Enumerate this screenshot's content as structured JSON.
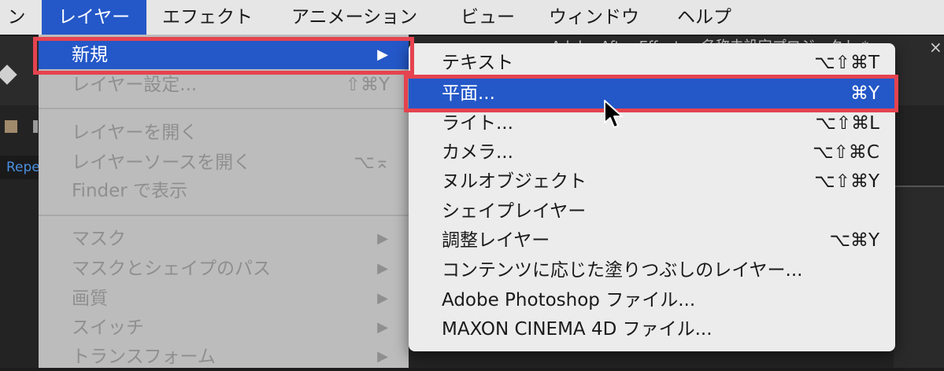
{
  "app": {
    "window_title": "Adobe After Effects - 名称未設定プロジェクト *",
    "panel_tab_fragment": "Repe"
  },
  "menubar": {
    "items": [
      {
        "label": "ン"
      },
      {
        "label": "レイヤー",
        "active": true
      },
      {
        "label": "エフェクト"
      },
      {
        "label": "アニメーション"
      },
      {
        "label": "ビュー"
      },
      {
        "label": "ウィンドウ"
      },
      {
        "label": "ヘルプ"
      }
    ]
  },
  "layer_menu": {
    "items": [
      {
        "label": "新規",
        "submenu_arrow": "▶",
        "active": true,
        "enabled": true
      },
      {
        "label": "レイヤー設定...",
        "shortcut": "⇧⌘Y",
        "enabled": false
      },
      {
        "label": "レイヤーを開く",
        "enabled": false
      },
      {
        "label": "レイヤーソースを開く",
        "shortcut": "⌥⌅",
        "enabled": false
      },
      {
        "label": "Finder で表示",
        "enabled": false
      },
      {
        "label": "マスク",
        "submenu_arrow": "▶",
        "enabled": false
      },
      {
        "label": "マスクとシェイプのパス",
        "submenu_arrow": "▶",
        "enabled": false
      },
      {
        "label": "画質",
        "submenu_arrow": "▶",
        "enabled": false
      },
      {
        "label": "スイッチ",
        "submenu_arrow": "▶",
        "enabled": false
      },
      {
        "label": "トランスフォーム",
        "submenu_arrow": "▶",
        "enabled": false
      }
    ]
  },
  "new_submenu": {
    "items": [
      {
        "label": "テキスト",
        "shortcut": "⌥⇧⌘T"
      },
      {
        "label": "平面...",
        "shortcut": "⌘Y",
        "active": true
      },
      {
        "label": "ライト...",
        "shortcut": "⌥⇧⌘L"
      },
      {
        "label": "カメラ...",
        "shortcut": "⌥⇧⌘C"
      },
      {
        "label": "ヌルオブジェクト",
        "shortcut": "⌥⇧⌘Y"
      },
      {
        "label": "シェイプレイヤー",
        "shortcut": ""
      },
      {
        "label": "調整レイヤー",
        "shortcut": "⌥⌘Y"
      },
      {
        "label": "コンテンツに応じた塗りつぶしのレイヤー...",
        "shortcut": ""
      },
      {
        "label": "Adobe Photoshop ファイル...",
        "shortcut": ""
      },
      {
        "label": "MAXON CINEMA 4D ファイル...",
        "shortcut": ""
      }
    ]
  },
  "colors": {
    "menu_highlight": "#2458c8",
    "annotation_frame": "#e5434f",
    "menubar_bg": "#e6e6e6",
    "menu_bg": "#bcbcbc",
    "submenu_bg": "#ececec"
  },
  "icons": {
    "cursor": "arrow-cursor-icon",
    "pen_tool": "pen-tool-icon",
    "close": "close-icon"
  }
}
